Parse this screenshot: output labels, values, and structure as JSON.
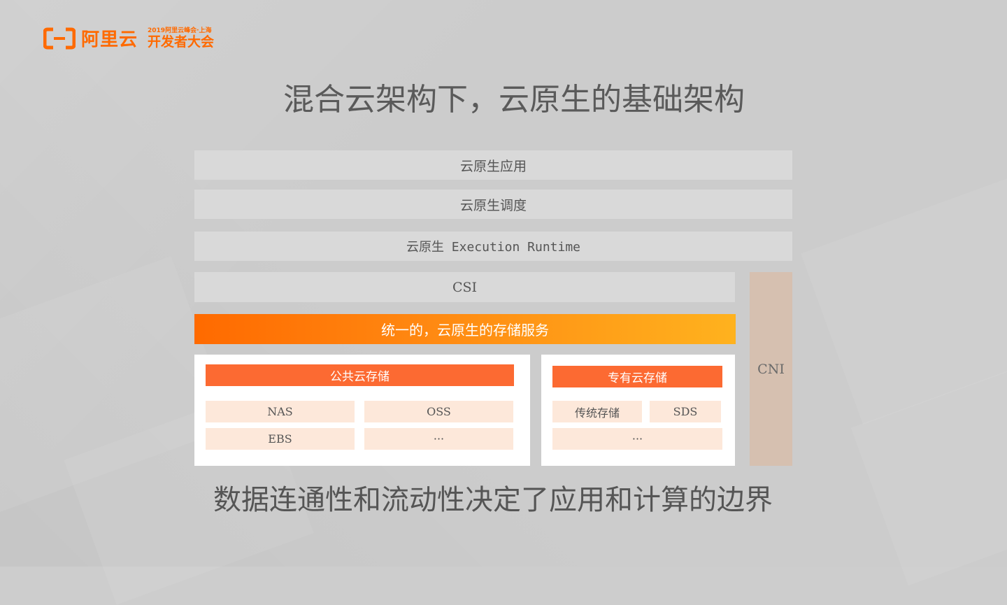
{
  "logo": {
    "brand": "阿里云",
    "event_line1": "2019阿里云峰会·上海",
    "event_line2": "开发者大会",
    "accent": "#ff6a00"
  },
  "title": "混合云架构下，云原生的基础架构",
  "layers": {
    "app": "云原生应用",
    "scheduling": "云原生调度",
    "runtime": "云原生 Execution Runtime",
    "csi": "CSI",
    "unified_storage": "统一的，云原生的存储服务",
    "cni": "CNI"
  },
  "public_cloud": {
    "title": "公共云存储",
    "items": [
      "NAS",
      "OSS",
      "EBS",
      "···"
    ]
  },
  "private_cloud": {
    "title": "专有云存储",
    "items": [
      "传统存储",
      "SDS",
      "···"
    ]
  },
  "footer": "数据连通性和流动性决定了应用和计算的边界",
  "colors": {
    "orange_start": "#ff6a00",
    "orange_end": "#ffb21e",
    "panel_head": "#fc6a32",
    "cell": "#fde8da",
    "cni": "#d6c0b0",
    "bar": "#d9d9d9"
  }
}
